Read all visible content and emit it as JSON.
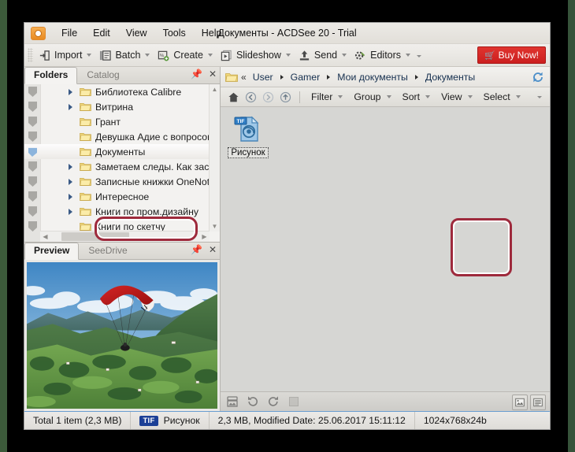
{
  "window": {
    "title": "Документы - ACDSee 20 - Trial",
    "logo_icon": "acdsee-camera-icon"
  },
  "menu": {
    "items": [
      {
        "label": "File",
        "name": "menu-file"
      },
      {
        "label": "Edit",
        "name": "menu-edit"
      },
      {
        "label": "View",
        "name": "menu-view"
      },
      {
        "label": "Tools",
        "name": "menu-tools"
      },
      {
        "label": "Help",
        "name": "menu-help"
      }
    ]
  },
  "toolbar": {
    "buttons": [
      {
        "label": "Import",
        "icon": "import-icon"
      },
      {
        "label": "Batch",
        "icon": "batch-icon"
      },
      {
        "label": "Create",
        "icon": "create-icon"
      },
      {
        "label": "Slideshow",
        "icon": "slideshow-icon"
      },
      {
        "label": "Send",
        "icon": "send-icon"
      },
      {
        "label": "Editors",
        "icon": "editors-icon"
      }
    ],
    "buy_now": "Buy Now!",
    "buy_now_icon": "cart-icon",
    "buy_now_color": "#cf2222"
  },
  "left_panel": {
    "tabs": [
      {
        "label": "Folders",
        "active": true
      },
      {
        "label": "Catalog",
        "active": false
      }
    ],
    "pin_icon": "pin-icon",
    "close_icon": "close-icon",
    "tree": [
      {
        "label": "Библиотека Calibre",
        "expandable": true,
        "selected": false
      },
      {
        "label": "Витрина",
        "expandable": true,
        "selected": false
      },
      {
        "label": "Грант",
        "expandable": false,
        "selected": false
      },
      {
        "label": "Девушка Адие с вопросом о",
        "expandable": false,
        "selected": false
      },
      {
        "label": "Документы",
        "expandable": false,
        "selected": true
      },
      {
        "label": "Заметаем следы. Как заста",
        "expandable": true,
        "selected": false
      },
      {
        "label": "Записные книжки OneNote",
        "expandable": true,
        "selected": false
      },
      {
        "label": "Интересное",
        "expandable": true,
        "selected": false
      },
      {
        "label": "Книги по пром.дизайну",
        "expandable": true,
        "selected": false
      },
      {
        "label": "Книги по скетчу",
        "expandable": false,
        "selected": false
      }
    ]
  },
  "preview_panel": {
    "tabs": [
      {
        "label": "Preview",
        "active": true
      },
      {
        "label": "SeeDrive",
        "active": false
      }
    ],
    "pin_icon": "pin-icon",
    "close_icon": "close-icon",
    "image_description": "paraglider-over-green-alpine-hills"
  },
  "breadcrumb": {
    "folder_icon": "folder-icon",
    "overflow": "«",
    "segments": [
      "User",
      "Gamer",
      "Мои документы",
      "Документы"
    ],
    "refresh_icon": "refresh-icon"
  },
  "navbar": {
    "icons": [
      {
        "name": "home-icon"
      },
      {
        "name": "back-icon"
      },
      {
        "name": "forward-icon"
      },
      {
        "name": "up-icon"
      }
    ],
    "buttons": [
      {
        "label": "Filter"
      },
      {
        "label": "Group"
      },
      {
        "label": "Sort"
      },
      {
        "label": "View"
      },
      {
        "label": "Select"
      }
    ]
  },
  "files": [
    {
      "name": "Рисунок",
      "type_badge": "TIF",
      "icon": "tif-image-file-icon",
      "selected": true
    }
  ],
  "bottom_bar": {
    "left_icons": [
      {
        "name": "thumbnail-info-icon"
      },
      {
        "name": "rotate-left-icon"
      },
      {
        "name": "rotate-right-icon"
      },
      {
        "name": "stop-icon"
      }
    ],
    "right_toggles": [
      {
        "name": "thumbnail-view-toggle"
      },
      {
        "name": "list-view-toggle"
      }
    ]
  },
  "statusbar": {
    "total": "Total 1 item  (2,3 MB)",
    "type_badge": "TIF",
    "filename": "Рисунок",
    "details": "2,3 MB, Modified Date: 25.06.2017 15:11:12",
    "dimensions": "1024x768x24b"
  },
  "annotations": {
    "highlight_color": "#9e2a3c",
    "regions": [
      "selected-folder-documents",
      "selected-file-risunok"
    ]
  }
}
